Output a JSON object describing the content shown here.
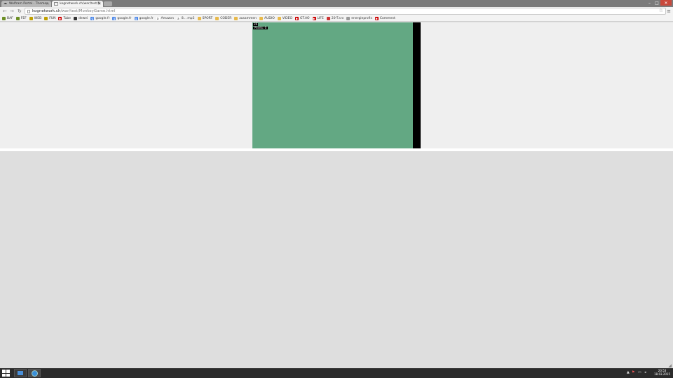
{
  "tabs": [
    {
      "title": "Wolfram Portal - Themen",
      "icon": "cloud-icon",
      "active": false
    },
    {
      "title": "kognetwork.ch/war/test/M",
      "icon": "page-icon",
      "active": true
    }
  ],
  "address": {
    "host": "kognetwork.ch",
    "path": "/war/test/MonkeyGame.html"
  },
  "bookmarks": [
    {
      "label": "BAF",
      "icon": "cloud-icon",
      "color": "#6b8e23"
    },
    {
      "label": "FEF",
      "icon": "cloud-icon",
      "color": "#6b8e23"
    },
    {
      "label": "WEB",
      "icon": "cloud-icon",
      "color": "#c0a000"
    },
    {
      "label": "FUN",
      "icon": "cloud-icon",
      "color": "#c0a000"
    },
    {
      "label": "Tube",
      "icon": "youtube-icon",
      "color": "#cc0000"
    },
    {
      "label": "dewei",
      "icon": "person-icon",
      "color": "#333333"
    },
    {
      "label": "google.fr",
      "icon": "google-icon",
      "color": "#4a86e8"
    },
    {
      "label": "google.fr",
      "icon": "google-icon",
      "color": "#4a86e8"
    },
    {
      "label": "google.fr",
      "icon": "google-icon",
      "color": "#4a86e8"
    },
    {
      "label": "Amazon",
      "icon": "amazon-icon",
      "color": "#222222"
    },
    {
      "label": "8... mp3",
      "icon": "amazon-icon",
      "color": "#222222"
    },
    {
      "label": "SPORT",
      "icon": "folder-icon",
      "color": "#e8b94a"
    },
    {
      "label": "CODER",
      "icon": "folder-icon",
      "color": "#e8b94a"
    },
    {
      "label": "zusammen",
      "icon": "folder-icon",
      "color": "#e8b94a"
    },
    {
      "label": "AUDIO",
      "icon": "folder-icon",
      "color": "#e8b94a"
    },
    {
      "label": "VIDEO",
      "icon": "folder-icon",
      "color": "#e8b94a"
    },
    {
      "label": "GT.AO",
      "icon": "youtube-icon",
      "color": "#cc0000"
    },
    {
      "label": "LIFE",
      "icon": "youtube-icon",
      "color": "#cc0000"
    },
    {
      "label": "20-T.srv",
      "icon": "flag-icon",
      "color": "#cc3333"
    },
    {
      "label": "energieprofis",
      "icon": "page-icon",
      "color": "#999999"
    },
    {
      "label": "Comment",
      "icon": "youtube-icon",
      "color": "#cc0000"
    }
  ],
  "game": {
    "score_label": "26",
    "score_value": "Points: 0"
  },
  "clock": {
    "time": "20:53",
    "date": "18.03.2015"
  },
  "colors": {
    "canvas": "#63a883",
    "taskbar": "#2b2b2b",
    "tabstrip": "#7b7b7b"
  }
}
